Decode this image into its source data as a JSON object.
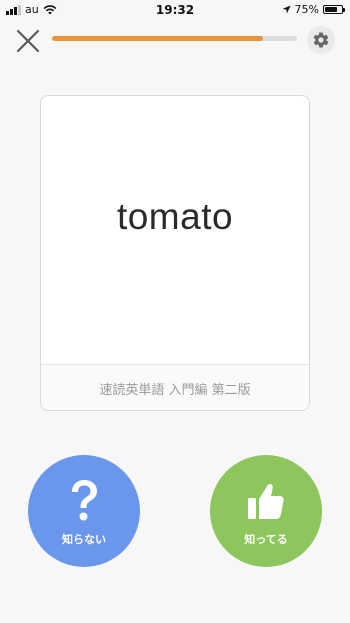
{
  "status_bar": {
    "carrier": "au",
    "time": "19:32",
    "battery": "75%",
    "battery_level": 0.75
  },
  "top_bar": {
    "progress": 0.86
  },
  "card": {
    "word": "tomato",
    "source": "速読英単語 入門編 第二版"
  },
  "actions": {
    "unknown_label": "知らない",
    "known_label": "知ってる"
  },
  "colors": {
    "progress": "#e8943a",
    "unknown": "#6a96ec",
    "known": "#8cc65c"
  },
  "icons": {
    "close": "close-icon",
    "settings": "gear-icon",
    "unknown": "question-icon",
    "known": "thumbs-up-icon"
  }
}
